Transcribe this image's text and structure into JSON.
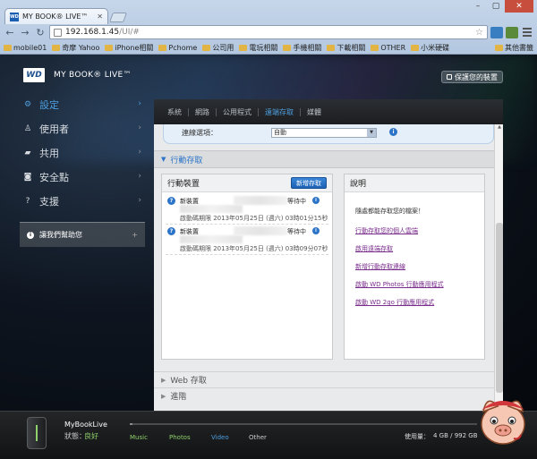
{
  "browser": {
    "tab_title": "MY BOOK® LIVE™",
    "tab_favicon": "WD",
    "url_host": "192.168.1.45",
    "url_path": "/UI/#",
    "bookmarks": [
      "mobile01",
      "奇摩 Yahoo",
      "iPhone相關",
      "Pchome",
      "公司用",
      "電玩相關",
      "手機相關",
      "下載相關",
      "OTHER",
      "小米硬碟"
    ],
    "bookmark_other": "其他書籤"
  },
  "app": {
    "logo": "WD",
    "product_name": "MY BOOK® LIVE™",
    "secure_button": "保護您的裝置"
  },
  "sidebar": {
    "items": [
      {
        "label": "設定",
        "icon": "gear-icon"
      },
      {
        "label": "使用者",
        "icon": "user-icon"
      },
      {
        "label": "共用",
        "icon": "folder-icon"
      },
      {
        "label": "安全點",
        "icon": "safepoint-icon"
      },
      {
        "label": "支援",
        "icon": "question-icon"
      }
    ],
    "help_text": "讓我們幫助您"
  },
  "subtabs": [
    "系統",
    "網路",
    "公用程式",
    "遠端存取",
    "媒體"
  ],
  "connection": {
    "label": "連線選項：",
    "value": "自動"
  },
  "mobile_access": {
    "title": "行動存取"
  },
  "devices": {
    "title": "行動裝置",
    "add_button": "新增存取",
    "items": [
      {
        "name": "新裝置",
        "status": "等待中",
        "date": "啟動碼期限 2013年05月25日 (週六) 03時01分15秒"
      },
      {
        "name": "新裝置",
        "status": "等待中",
        "date": "啟動碼期限 2013年05月25日 (週六) 03時09分07秒"
      }
    ]
  },
  "explanation": {
    "title": "說明",
    "text": "隨處都能存取您的檔案！",
    "links": [
      "行動存取您的個人雲端",
      "啟用遠端存取",
      "新增行動存取連線",
      "啟動 WD Photos 行動應用程式",
      "啟動 WD 2go 行動應用程式"
    ]
  },
  "collapsed_sections": [
    "Web 存取",
    "進階"
  ],
  "footer": {
    "device_name": "MyBookLive",
    "status_label": "狀態：",
    "status_value": "良好",
    "categories": [
      {
        "name": "Music",
        "color": "#8fd16c"
      },
      {
        "name": "Photos",
        "color": "#8fd16c"
      },
      {
        "name": "Video",
        "color": "#4e9fe0"
      },
      {
        "name": "Other",
        "color": "#cccccc"
      }
    ],
    "usage_label": "使用量：",
    "usage_value": "4 GB / 992 GB"
  },
  "colors": {
    "accent": "#4e9fe0",
    "good": "#8fd16c",
    "button": "#1e62b4"
  }
}
